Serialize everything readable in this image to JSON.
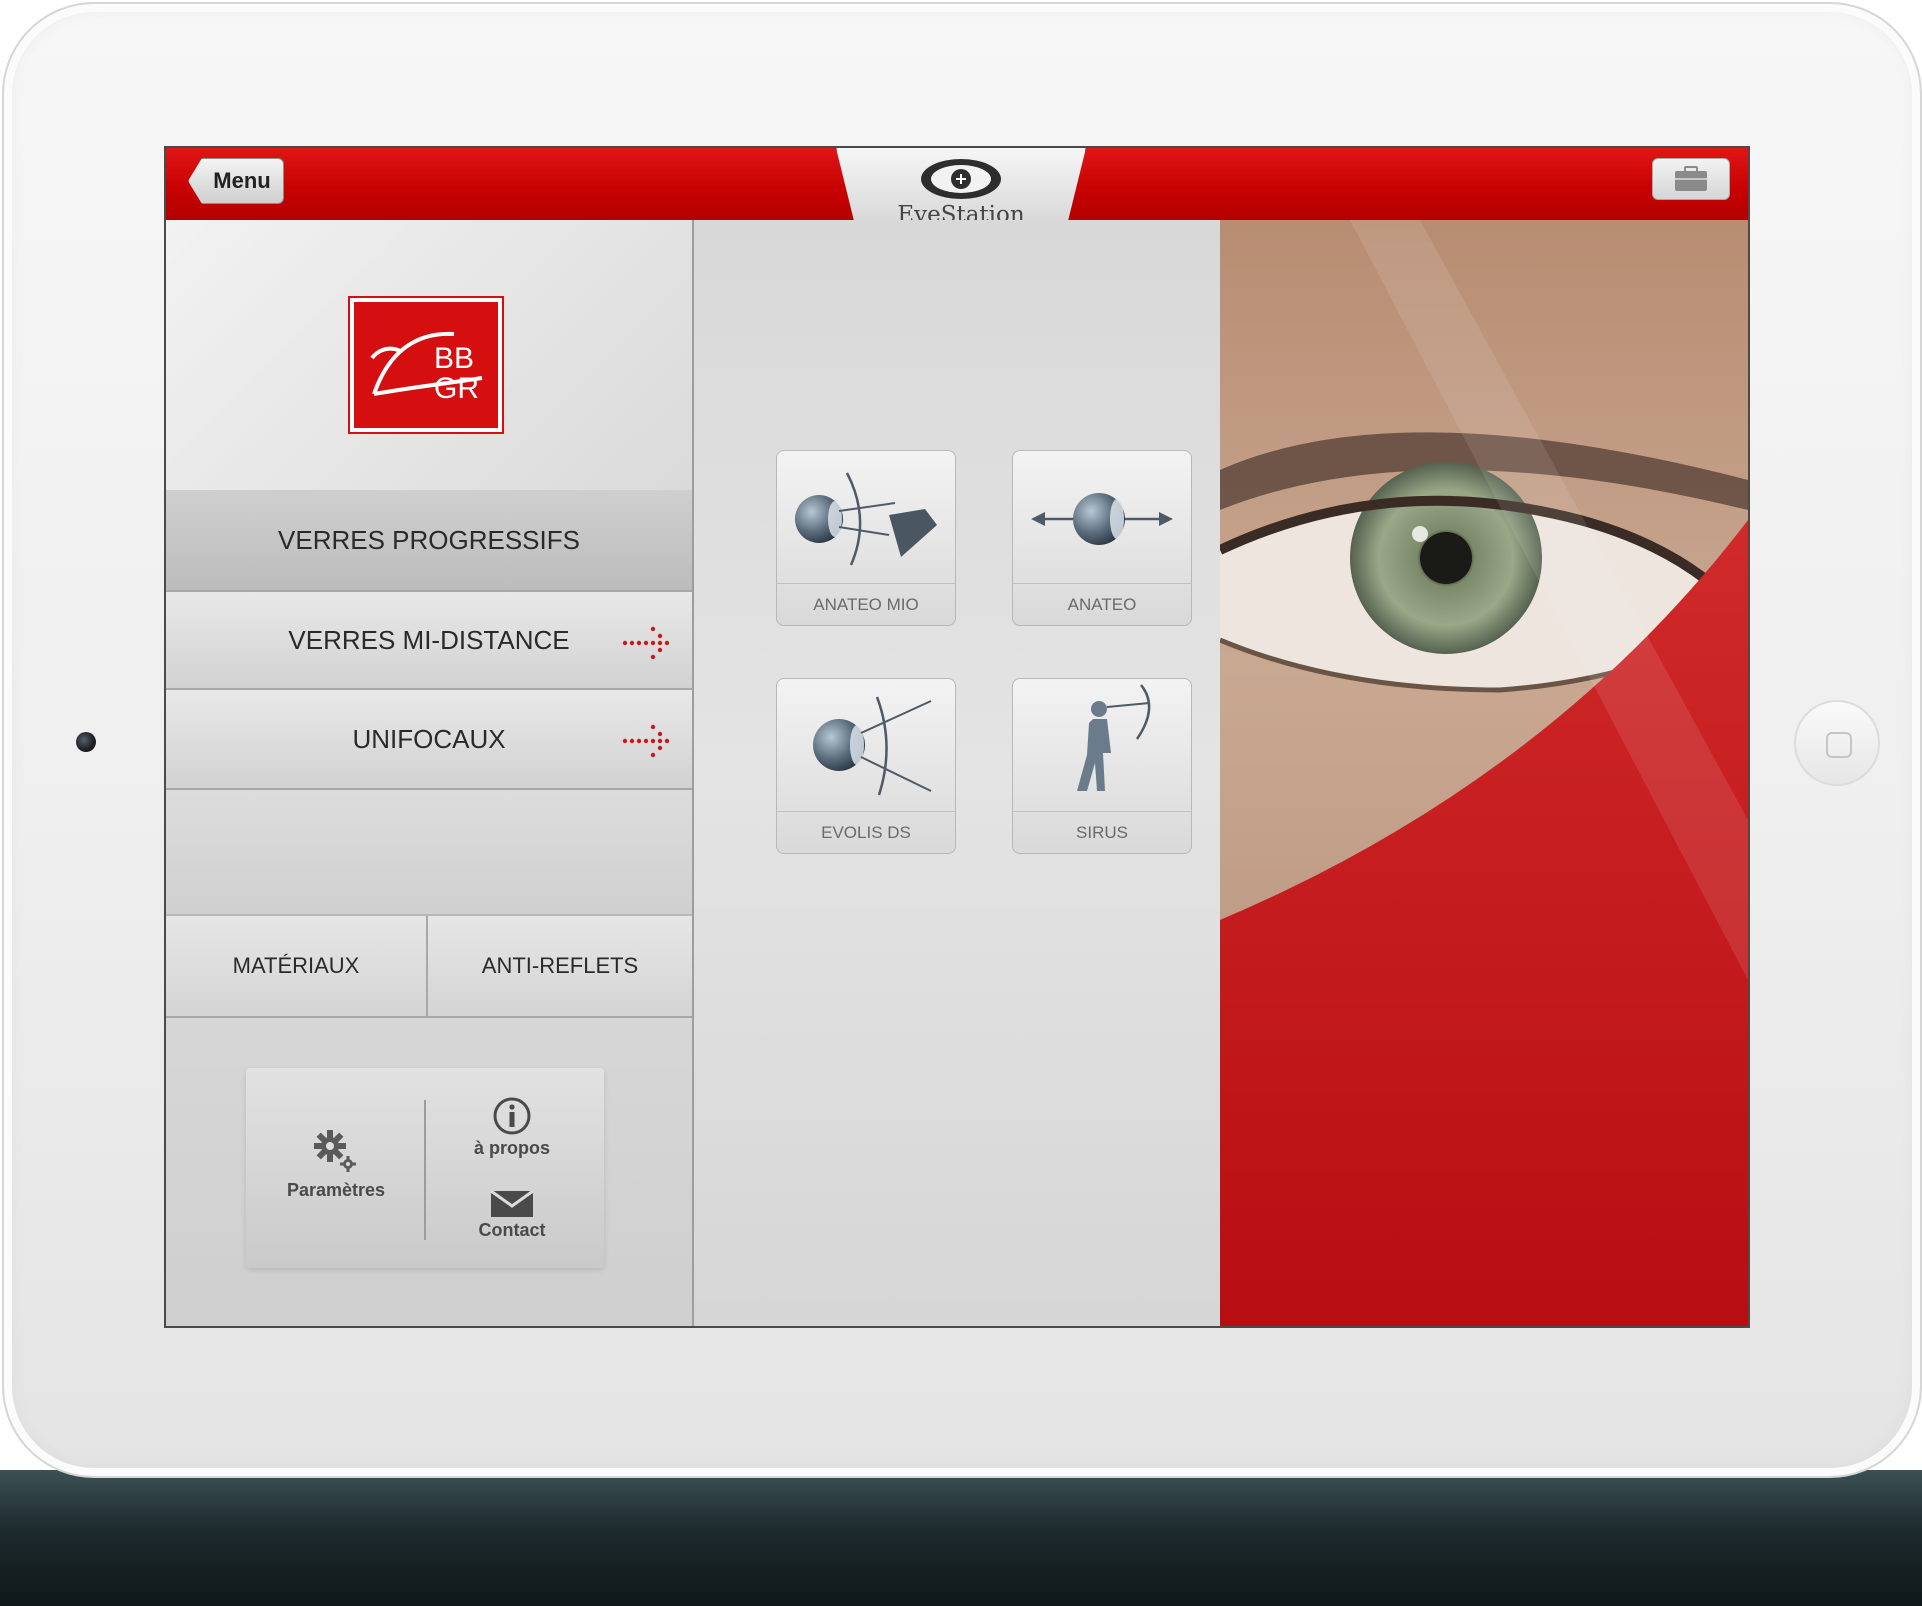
{
  "header": {
    "menu_label": "Menu",
    "app_title": "EyeStation"
  },
  "brand": {
    "logo_text_top": "BB",
    "logo_text_bottom": "GR",
    "accent_color": "#d50f0f"
  },
  "nav": {
    "items": [
      {
        "label": "VERRES PROGRESSIFS",
        "has_arrow": false
      },
      {
        "label": "VERRES MI-DISTANCE",
        "has_arrow": true
      },
      {
        "label": "UNIFOCAUX",
        "has_arrow": true
      }
    ],
    "split": [
      {
        "label": "MATÉRIAUX"
      },
      {
        "label": "ANTI-REFLETS"
      }
    ]
  },
  "footer_buttons": {
    "settings": "Paramètres",
    "about": "à propos",
    "contact": "Contact"
  },
  "products": [
    {
      "label": "ANATEO MIO",
      "icon": "lens-eye-book-icon"
    },
    {
      "label": "ANATEO",
      "icon": "lens-eye-arrows-icon"
    },
    {
      "label": "EVOLIS DS",
      "icon": "lens-eye-curve-icon"
    },
    {
      "label": "SIRUS",
      "icon": "walking-person-icon"
    }
  ]
}
